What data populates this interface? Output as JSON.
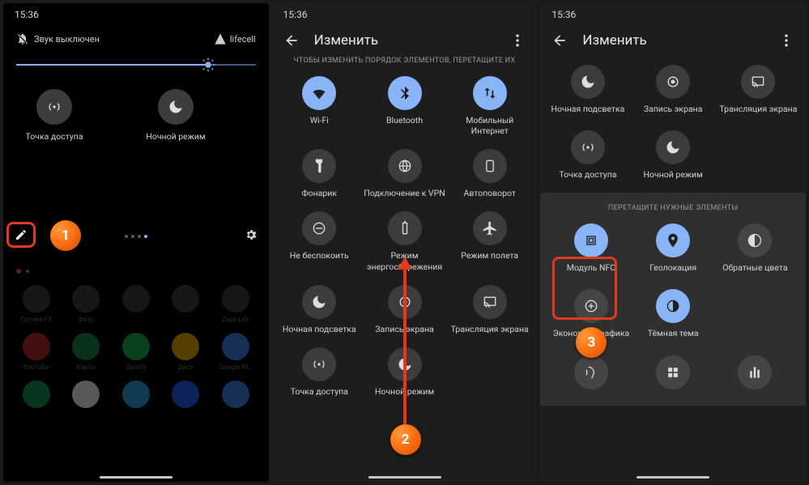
{
  "time": "15:36",
  "p1": {
    "sound_off": "Звук выключен",
    "carrier": "lifecell",
    "tile_hotspot": "Точка доступа",
    "tile_night": "Ночной режим",
    "home_row1": [
      "Camera FX",
      "Фото",
      "",
      "",
      "Zapp Life"
    ],
    "home_row2": [
      "YouTube",
      "Карты",
      "Spotify",
      "Диск",
      "Google Pl…"
    ]
  },
  "p2": {
    "title": "Изменить",
    "hint": "ЧТОБЫ ИЗМЕНИТЬ ПОРЯДОК ЭЛЕМЕНТОВ, ПЕРЕТАЩИТЕ ИХ",
    "tiles": [
      "Wi-Fi",
      "Bluetooth",
      "Мобильный Интернет",
      "Фонарик",
      "Подключение к VPN",
      "Автоповорот",
      "Не беспокоить",
      "Режим энергосбережения",
      "Режим полета",
      "Ночная подсветка",
      "Запись экрана",
      "Трансляция экрана",
      "Точка доступа",
      "Ночной режим",
      ""
    ]
  },
  "p3": {
    "title": "Изменить",
    "hint": "ПЕРЕТАЩИТЕ НУЖНЫЕ ЭЛЕМЕНТЫ",
    "tiles_top": [
      "Ночная подсветка",
      "Запись экрана",
      "Трансляция экрана",
      "Точка доступа",
      "Ночной режим",
      ""
    ],
    "tiles_tray": [
      "Модуль NFC",
      "Геолокация",
      "Обратные цвета",
      "Экономия трафика",
      "Тёмная тема",
      "",
      "",
      "",
      ""
    ]
  },
  "badges": {
    "b1": "1",
    "b2": "2",
    "b3": "3"
  }
}
